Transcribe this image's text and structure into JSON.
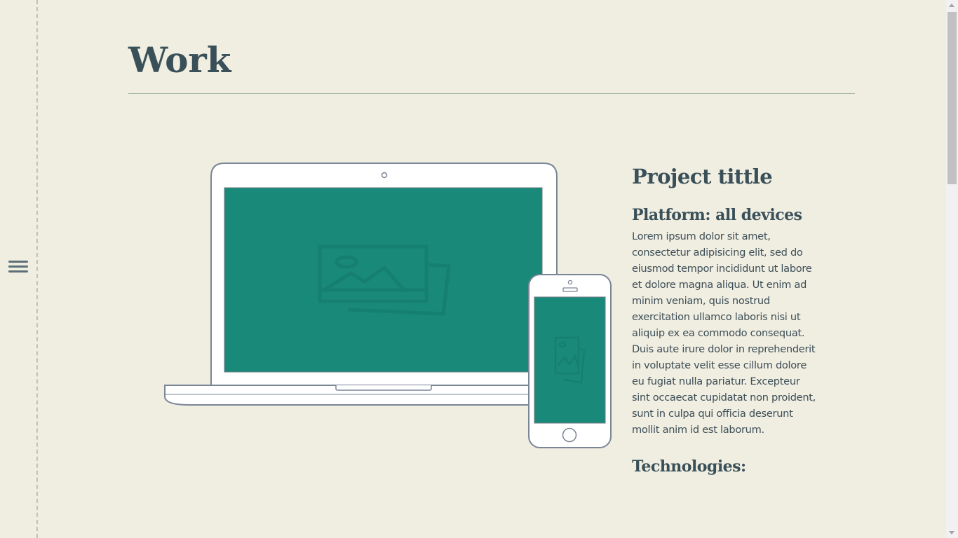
{
  "nav": {
    "menu_icon": "hamburger-menu-icon"
  },
  "header": {
    "title": "Work"
  },
  "project": {
    "title": "Project tittle",
    "platform": "Platform: all devices",
    "description": "Lorem ipsum dolor sit amet, consectetur adipisicing elit, sed do eiusmod tempor incididunt ut labore et dolore magna aliqua. Ut enim ad minim veniam, quis nostrud exercitation ullamco laboris nisi ut aliquip ex ea commodo consequat. Duis aute irure dolor in reprehenderit in voluptate velit esse cillum dolore eu fugiat nulla pariatur. Excepteur sint occaecat cupidatat non proident, sunt in culpa qui officia deserunt mollit anim id est laborum.",
    "technologies_heading": "Technologies:"
  },
  "devices": {
    "laptop_icon": "laptop-icon",
    "phone_icon": "phone-icon",
    "placeholder_icon": "image-placeholder-icon"
  },
  "colors": {
    "background": "#f0ede1",
    "heading": "#3a5059",
    "screen": "#19897a",
    "device_outline": "#7a8596"
  }
}
